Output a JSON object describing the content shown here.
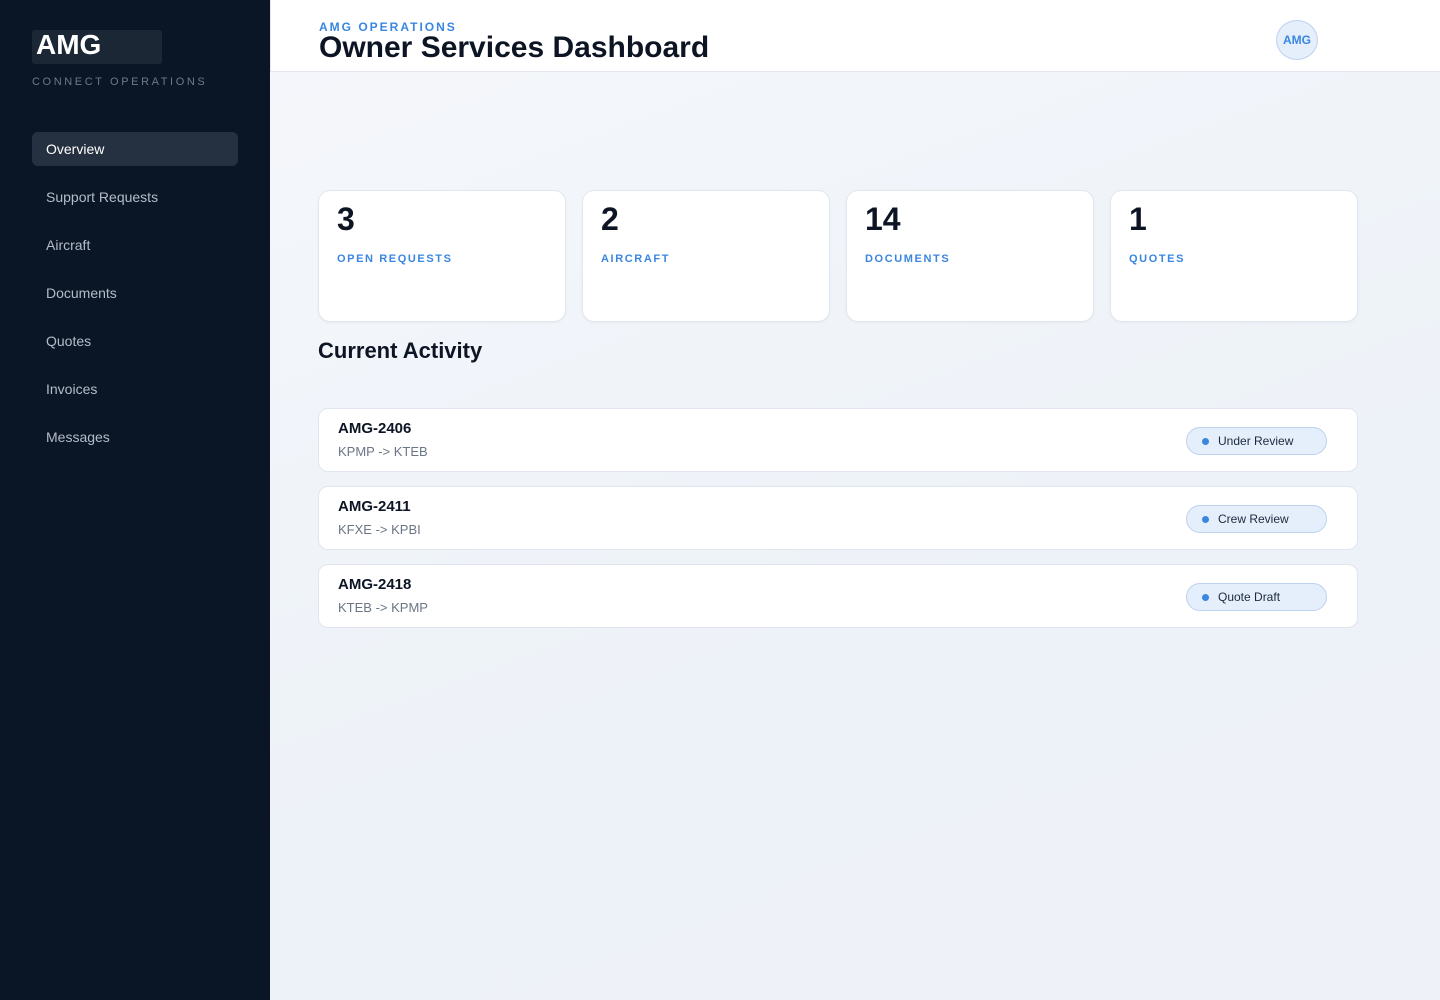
{
  "sidebar": {
    "brand": "AMG",
    "subtitle": "CONNECT OPERATIONS",
    "items": [
      {
        "label": "Overview",
        "active": true
      },
      {
        "label": "Support Requests",
        "active": false
      },
      {
        "label": "Aircraft",
        "active": false
      },
      {
        "label": "Documents",
        "active": false
      },
      {
        "label": "Quotes",
        "active": false
      },
      {
        "label": "Invoices",
        "active": false
      },
      {
        "label": "Messages",
        "active": false
      }
    ]
  },
  "header": {
    "eyebrow": "AMG OPERATIONS",
    "title": "Owner Services Dashboard",
    "avatar": "AMG"
  },
  "stats": [
    {
      "value": "3",
      "label": "OPEN REQUESTS"
    },
    {
      "value": "2",
      "label": "AIRCRAFT"
    },
    {
      "value": "14",
      "label": "DOCUMENTS"
    },
    {
      "value": "1",
      "label": "QUOTES"
    }
  ],
  "activity": {
    "title": "Current Activity",
    "rows": [
      {
        "id": "AMG-2406",
        "route": "KPMP -> KTEB",
        "status": "Under Review"
      },
      {
        "id": "AMG-2411",
        "route": "KFXE -> KPBI",
        "status": "Crew Review"
      },
      {
        "id": "AMG-2418",
        "route": "KTEB -> KPMP",
        "status": "Quote Draft"
      }
    ]
  },
  "colors": {
    "sidebar_bg": "#0a1626",
    "accent": "#3a86e0",
    "title": "#0d1524"
  }
}
